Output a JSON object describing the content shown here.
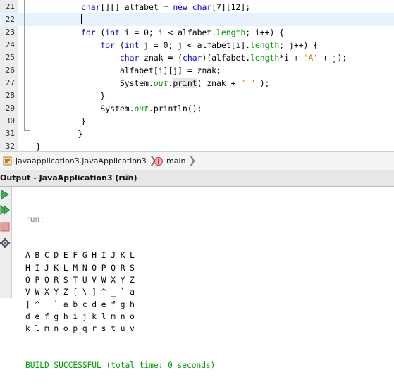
{
  "editor": {
    "lines": [
      {
        "n": "21",
        "segs": [
          {
            "t": "char",
            "c": "kw"
          },
          {
            "t": "[][] alfabet = "
          },
          {
            "t": "new",
            "c": "kw"
          },
          {
            "t": " "
          },
          {
            "t": "char",
            "c": "kw"
          },
          {
            "t": "[7][12];"
          }
        ]
      },
      {
        "n": "22",
        "segs": []
      },
      {
        "n": "23",
        "segs": [
          {
            "t": "for",
            "c": "kw"
          },
          {
            "t": " ("
          },
          {
            "t": "int",
            "c": "kw"
          },
          {
            "t": " i = 0; i < alfabet."
          },
          {
            "t": "length",
            "c": "fld"
          },
          {
            "t": "; i++) {"
          }
        ]
      },
      {
        "n": "24",
        "segs": [
          {
            "t": "    "
          },
          {
            "t": "for",
            "c": "kw"
          },
          {
            "t": " ("
          },
          {
            "t": "int",
            "c": "kw"
          },
          {
            "t": " j = 0; j < alfabet[i]."
          },
          {
            "t": "length",
            "c": "fld"
          },
          {
            "t": "; j++) {"
          }
        ]
      },
      {
        "n": "25",
        "segs": [
          {
            "t": "        "
          },
          {
            "t": "char",
            "c": "kw"
          },
          {
            "t": " znak = ("
          },
          {
            "t": "char",
            "c": "kw"
          },
          {
            "t": ")(alfabet."
          },
          {
            "t": "length",
            "c": "fld"
          },
          {
            "t": "*i + "
          },
          {
            "t": "'A'",
            "c": "str"
          },
          {
            "t": " + j);"
          }
        ]
      },
      {
        "n": "26",
        "segs": [
          {
            "t": "        alfabet[i][j] = znak;"
          }
        ]
      },
      {
        "n": "27",
        "segs": [
          {
            "t": "        System."
          },
          {
            "t": "out",
            "c": "ital"
          },
          {
            "t": "."
          },
          {
            "t": "print",
            "c": "mth"
          },
          {
            "t": "( znak + "
          },
          {
            "t": "\" \"",
            "c": "str"
          },
          {
            "t": " );"
          }
        ]
      },
      {
        "n": "28",
        "segs": [
          {
            "t": "    }"
          }
        ]
      },
      {
        "n": "29",
        "segs": [
          {
            "t": "    System."
          },
          {
            "t": "out",
            "c": "ital"
          },
          {
            "t": ".println();"
          }
        ]
      },
      {
        "n": "30",
        "segs": [
          {
            "t": "}"
          }
        ]
      },
      {
        "n": "31",
        "segs": [
          {
            "t": "    }"
          }
        ],
        "indent": -1
      },
      {
        "n": "32",
        "segs": [
          {
            "t": "}"
          }
        ],
        "indent": -2
      }
    ]
  },
  "breadcrumb": {
    "class_label": "javaapplication3.JavaApplication3",
    "method_label": "main"
  },
  "output": {
    "title": "Output - JavaApplication3 (run)",
    "close_glyph": "⊗",
    "run_label": "run:",
    "rows": [
      "A B C D E F G H I J K L",
      "H I J K L M N O P Q R S",
      "O P Q R S T U V W X Y Z",
      "V W X Y Z [ \\ ] ^ _ ` a",
      "] ^ _ ` a b c d e f g h",
      "d e f g h i j k l m n o",
      "k l m n o p q r s t u v"
    ],
    "status": "BUILD SUCCESSFUL (total time: 0 seconds)"
  },
  "colors": {
    "keyword": "#0000e6",
    "field": "#009900",
    "string": "#ce7b00",
    "success": "#009900"
  },
  "icons": [
    "class-icon",
    "method-icon",
    "rerun-icon",
    "rerun-different-icon",
    "stop-icon",
    "settings-icon"
  ]
}
